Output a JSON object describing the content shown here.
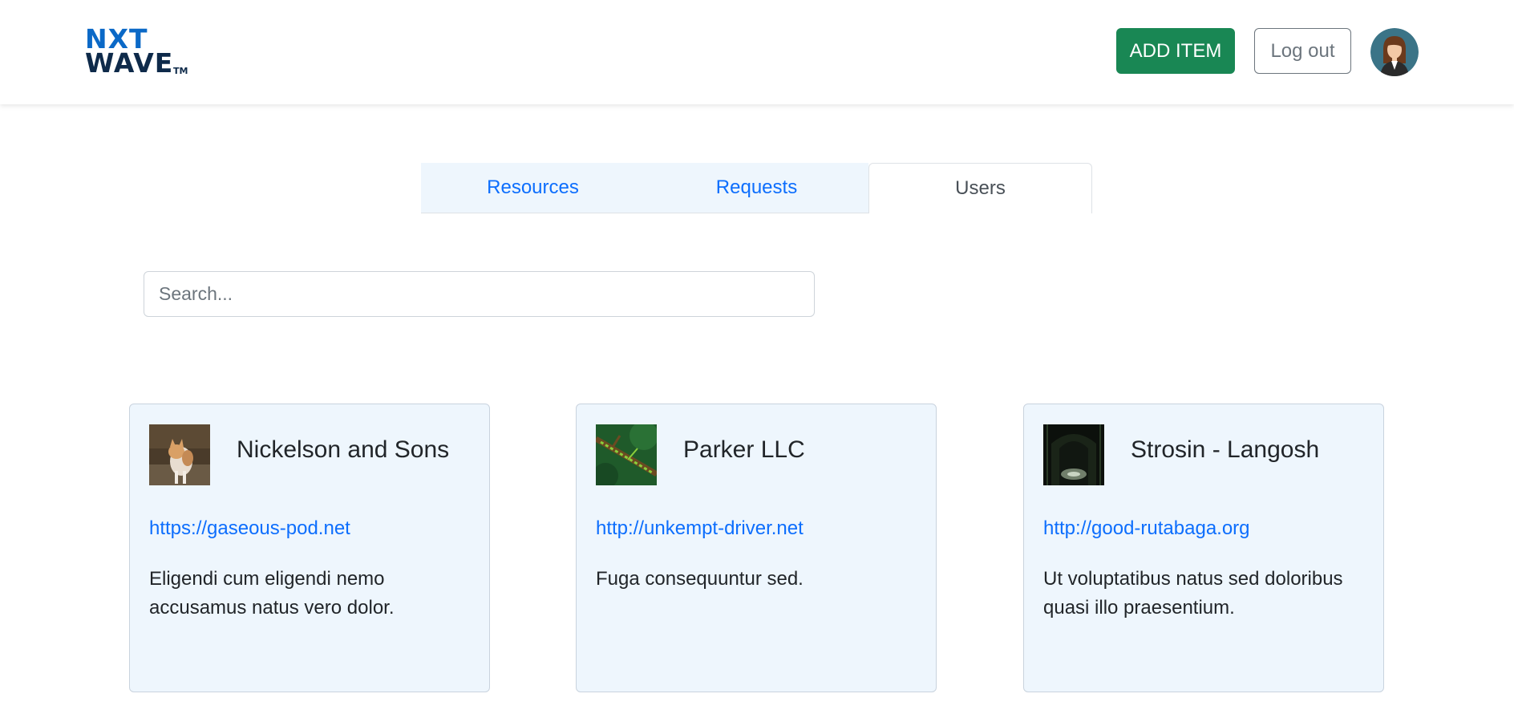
{
  "header": {
    "logo": {
      "line1": "NXT",
      "line2": "WAVE",
      "tm": "TM"
    },
    "add_item_label": "ADD ITEM",
    "logout_label": "Log out"
  },
  "tabs": [
    {
      "label": "Resources",
      "active": false
    },
    {
      "label": "Requests",
      "active": false
    },
    {
      "label": "Users",
      "active": true
    }
  ],
  "search": {
    "placeholder": "Search...",
    "value": ""
  },
  "cards": [
    {
      "title": "Nickelson and Sons",
      "link": "https://gaseous-pod.net",
      "description": "Eligendi cum eligendi nemo accusamus natus vero dolor.",
      "image_icon": "cat-photo-icon"
    },
    {
      "title": "Parker LLC",
      "link": "http://unkempt-driver.net",
      "description": "Fuga consequuntur sed.",
      "image_icon": "moss-branch-photo-icon"
    },
    {
      "title": "Strosin - Langosh",
      "link": "http://good-rutabaga.org",
      "description": "Ut voluptatibus natus sed doloribus quasi illo praesentium.",
      "image_icon": "tunnel-photo-icon"
    }
  ],
  "colors": {
    "primary": "#0d6efd",
    "success": "#198754",
    "card_bg": "#eef6fd",
    "logo_blue": "#0b69c7",
    "logo_navy": "#0e2a4a"
  }
}
